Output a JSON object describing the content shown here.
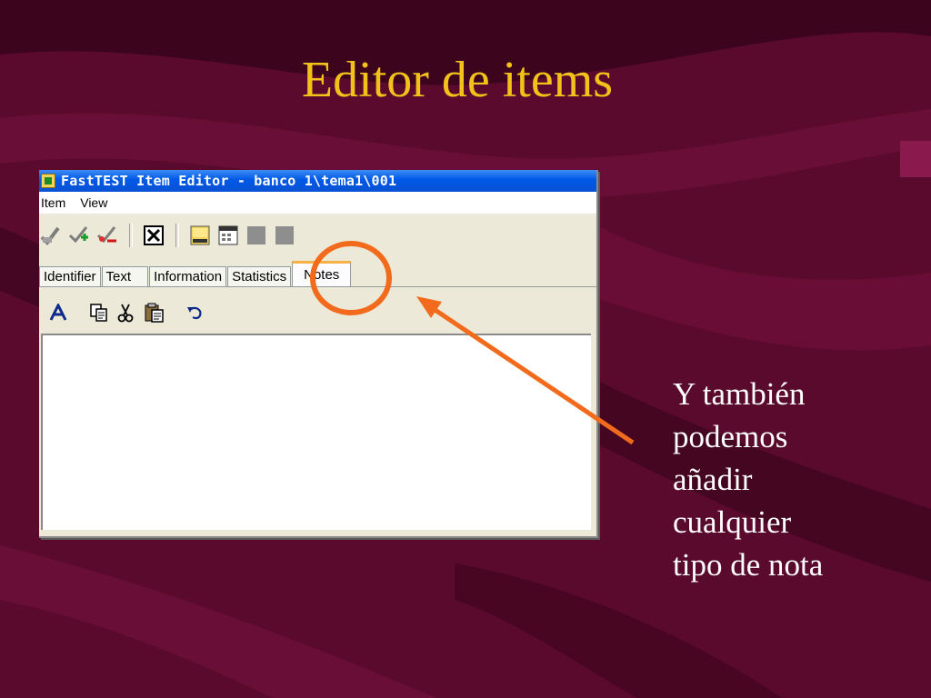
{
  "slide": {
    "title": "Editor de items",
    "body_lines": [
      "Y también",
      "podemos",
      "añadir",
      "cualquier",
      "tipo de nota"
    ]
  },
  "window": {
    "title": "FastTEST Item Editor - banco 1\\tema1\\001",
    "menu": [
      "Item",
      "View"
    ],
    "toolbar_icons": [
      "check-icon",
      "check-add-icon",
      "check-remove-icon",
      "close-x-icon",
      "note-icon",
      "calendar-icon",
      "gray-square-icon",
      "gray-square-icon"
    ],
    "tabs": [
      "Identifier",
      "Text",
      "Information",
      "Statistics",
      "Notes"
    ],
    "active_tab": "Notes",
    "edit_icons": [
      "font-icon",
      "copy-icon",
      "cut-icon",
      "paste-icon",
      "undo-icon"
    ]
  },
  "annotation": {
    "circle_color": "#f26b1d",
    "arrow_color": "#f26b1d"
  },
  "colors": {
    "title": "#f2c21a",
    "background": "#5c0a2e",
    "titlebar": "#0058e6"
  }
}
